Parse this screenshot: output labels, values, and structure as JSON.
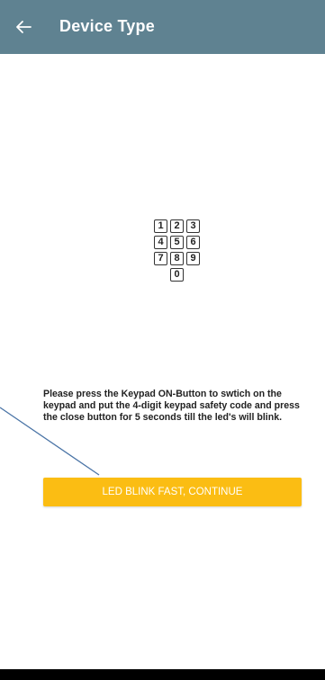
{
  "app_bar": {
    "back_icon": "arrow-left-icon",
    "title": "Device Type",
    "background_color": "#5f8291"
  },
  "keypad_illustration": {
    "keys": [
      "1",
      "2",
      "3",
      "4",
      "5",
      "6",
      "7",
      "8",
      "9",
      "0"
    ]
  },
  "instruction_text": "Please press the Keypad ON-Button to swtich on the keypad and put the 4-digit keypad safety code and press the close button for 5 seconds till the led's will blink.",
  "continue_button": {
    "label": "LED BLINK FAST, CONTINUE",
    "color": "#fbbd13"
  }
}
